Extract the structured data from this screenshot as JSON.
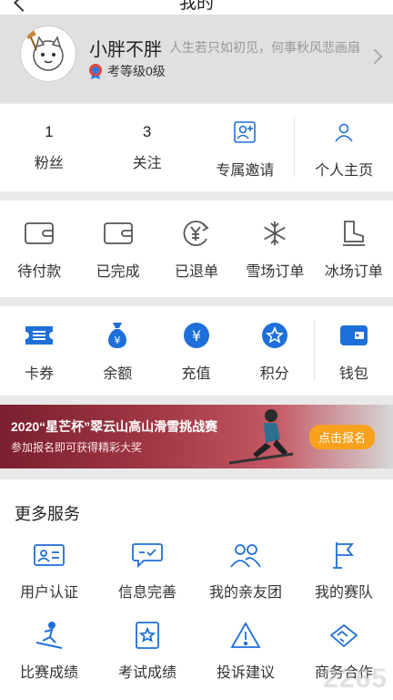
{
  "header": {
    "title": "我的"
  },
  "profile": {
    "username": "小胖不胖",
    "motto": "人生若只如初见，何事秋风悲画扇",
    "level": "考等级0级"
  },
  "stats": [
    {
      "value": "1",
      "label": "粉丝"
    },
    {
      "value": "3",
      "label": "关注"
    }
  ],
  "social": [
    {
      "label": "专属邀请",
      "icon": "invite-icon"
    },
    {
      "label": "个人主页",
      "icon": "person-icon"
    }
  ],
  "orders": [
    {
      "label": "待付款",
      "icon": "wallet-outline-icon"
    },
    {
      "label": "已完成",
      "icon": "wallet-outline-icon"
    },
    {
      "label": "已退单",
      "icon": "refund-icon"
    },
    {
      "label": "雪场订单",
      "icon": "snowflake-icon"
    },
    {
      "label": "冰场订单",
      "icon": "skate-icon"
    }
  ],
  "assets": [
    {
      "label": "卡券",
      "icon": "ticket-icon"
    },
    {
      "label": "余额",
      "icon": "money-bag-icon"
    },
    {
      "label": "充值",
      "icon": "yen-coin-icon"
    },
    {
      "label": "积分",
      "icon": "star-coin-icon"
    },
    {
      "label": "钱包",
      "icon": "wallet-icon"
    }
  ],
  "banner": {
    "line1": "2020“星芒杯”翠云山高山滑雪挑战赛",
    "line2": "参加报名即可获得精彩大奖",
    "cta": "点击报名"
  },
  "more_services": {
    "title": "更多服务",
    "items": [
      {
        "label": "用户认证",
        "icon": "id-card-icon"
      },
      {
        "label": "信息完善",
        "icon": "chat-check-icon"
      },
      {
        "label": "我的亲友团",
        "icon": "group-icon"
      },
      {
        "label": "我的赛队",
        "icon": "flag-icon"
      },
      {
        "label": "比赛成绩",
        "icon": "skier-icon"
      },
      {
        "label": "考试成绩",
        "icon": "star-badge-icon"
      },
      {
        "label": "投诉建议",
        "icon": "warning-icon"
      },
      {
        "label": "商务合作",
        "icon": "handshake-icon"
      }
    ]
  },
  "watermark": "2265",
  "colors": {
    "accent": "#1e6fd9",
    "background": "#e9e9e9"
  }
}
